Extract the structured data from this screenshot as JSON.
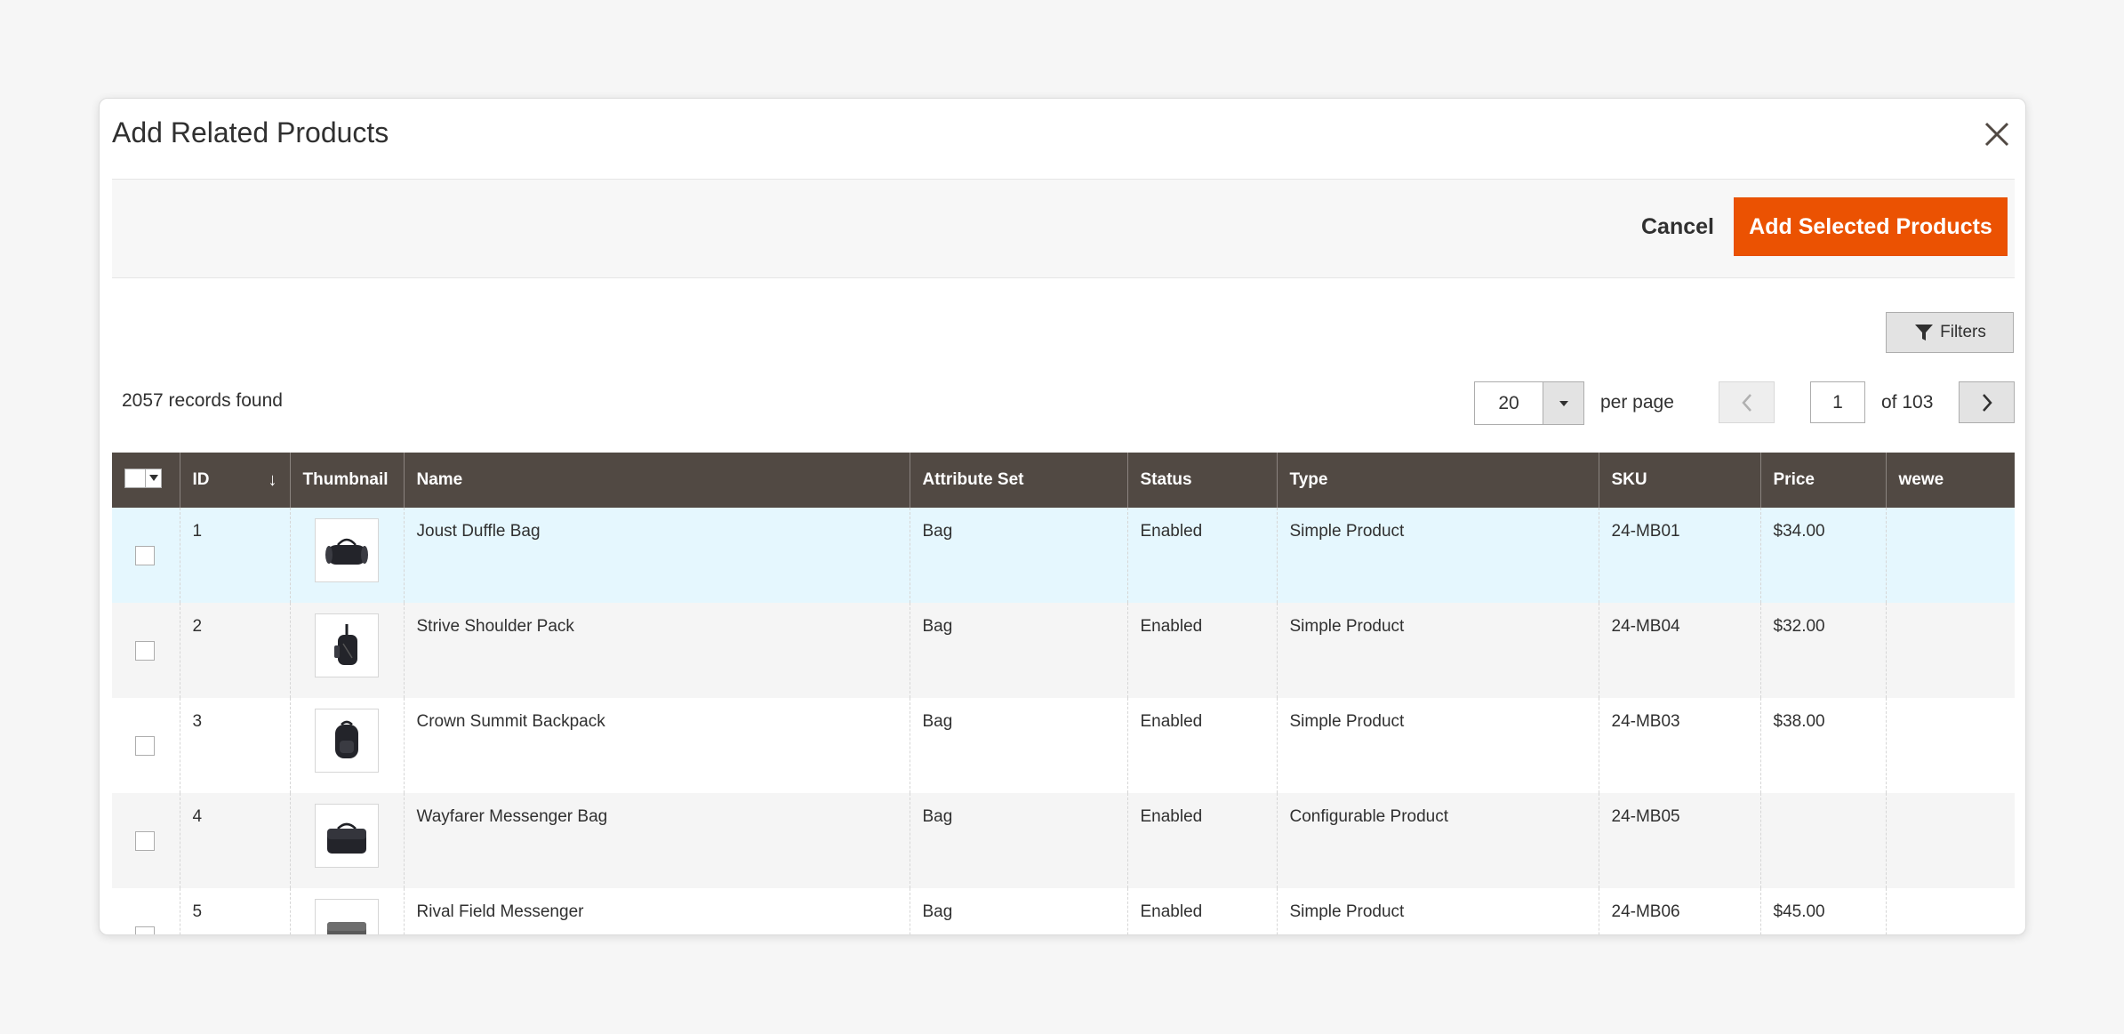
{
  "modal": {
    "title": "Add Related Products",
    "cancel_label": "Cancel",
    "add_label": "Add Selected Products"
  },
  "toolbar": {
    "filters_label": "Filters",
    "records_found": "2057 records found",
    "per_page_value": "20",
    "per_page_label": "per page",
    "current_page": "1",
    "total_pages_label": "of 103"
  },
  "colors": {
    "accent": "#eb5202",
    "header_bg": "#514943",
    "hover_row": "#e5f7fe"
  },
  "columns": [
    "ID",
    "Thumbnail",
    "Name",
    "Attribute Set",
    "Status",
    "Type",
    "SKU",
    "Price",
    "wewe"
  ],
  "rows": [
    {
      "id": "1",
      "name": "Joust Duffle Bag",
      "attribute_set": "Bag",
      "status": "Enabled",
      "type": "Simple Product",
      "sku": "24-MB01",
      "price": "$34.00",
      "wewe": "",
      "thumb_icon": "duffle-bag-icon"
    },
    {
      "id": "2",
      "name": "Strive Shoulder Pack",
      "attribute_set": "Bag",
      "status": "Enabled",
      "type": "Simple Product",
      "sku": "24-MB04",
      "price": "$32.00",
      "wewe": "",
      "thumb_icon": "shoulder-pack-icon"
    },
    {
      "id": "3",
      "name": "Crown Summit Backpack",
      "attribute_set": "Bag",
      "status": "Enabled",
      "type": "Simple Product",
      "sku": "24-MB03",
      "price": "$38.00",
      "wewe": "",
      "thumb_icon": "backpack-icon"
    },
    {
      "id": "4",
      "name": "Wayfarer Messenger Bag",
      "attribute_set": "Bag",
      "status": "Enabled",
      "type": "Configurable Product",
      "sku": "24-MB05",
      "price": "",
      "wewe": "",
      "thumb_icon": "messenger-bag-icon"
    },
    {
      "id": "5",
      "name": "Rival Field Messenger",
      "attribute_set": "Bag",
      "status": "Enabled",
      "type": "Simple Product",
      "sku": "24-MB06",
      "price": "$45.00",
      "wewe": "",
      "thumb_icon": "field-messenger-icon"
    }
  ]
}
